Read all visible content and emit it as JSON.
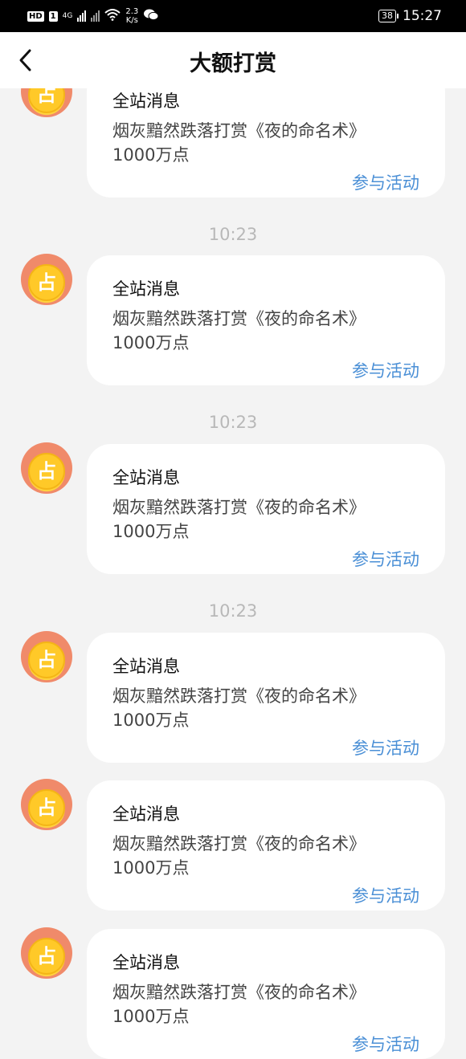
{
  "status_bar": {
    "hd_label": "HD",
    "sim_label": "1",
    "net_label": "4G",
    "speed_value": "2.3",
    "speed_unit": "K/s",
    "battery": "38",
    "time": "15:27"
  },
  "header": {
    "title": "大额打赏"
  },
  "messages": [
    {
      "title": "全站消息",
      "text": "烟灰黯然跌落打赏《夜的命名术》",
      "amount": "1000万点",
      "action": "参与活动",
      "avatar_glyph": "占"
    },
    {
      "title": "全站消息",
      "text": "烟灰黯然跌落打赏《夜的命名术》",
      "amount": "1000万点",
      "action": "参与活动",
      "avatar_glyph": "占"
    },
    {
      "title": "全站消息",
      "text": "烟灰黯然跌落打赏《夜的命名术》",
      "amount": "1000万点",
      "action": "参与活动",
      "avatar_glyph": "占"
    },
    {
      "title": "全站消息",
      "text": "烟灰黯然跌落打赏《夜的命名术》",
      "amount": "1000万点",
      "action": "参与活动",
      "avatar_glyph": "占"
    },
    {
      "title": "全站消息",
      "text": "烟灰黯然跌落打赏《夜的命名术》",
      "amount": "1000万点",
      "action": "参与活动",
      "avatar_glyph": "占"
    },
    {
      "title": "全站消息",
      "text": "烟灰黯然跌落打赏《夜的命名术》",
      "amount": "1000万点",
      "action": "参与活动",
      "avatar_glyph": "占"
    }
  ],
  "timestamps": [
    "10:23",
    "10:23",
    "10:23"
  ],
  "colors": {
    "link": "#4a8fd6",
    "background": "#f3f3f3",
    "timestamp": "#b8b8b8"
  }
}
